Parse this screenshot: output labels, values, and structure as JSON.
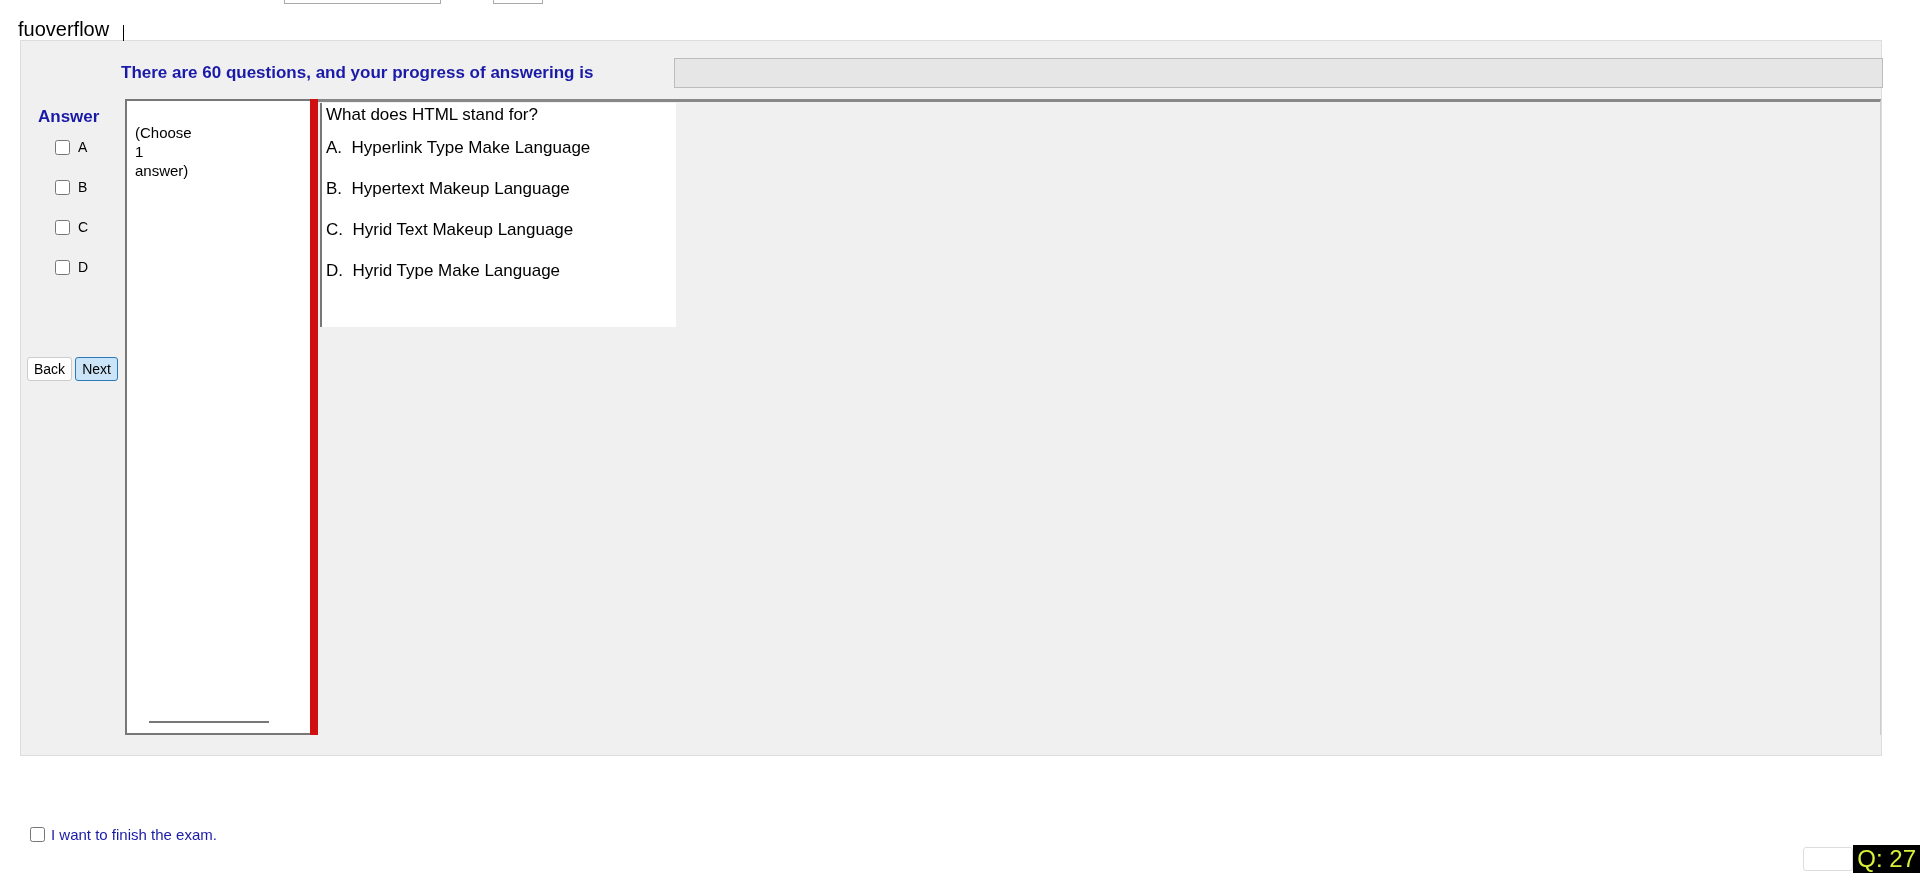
{
  "app_title": "fuoverflow",
  "progress": {
    "label": "There are 60 questions, and your progress of answering is",
    "level": 0
  },
  "answer_panel": {
    "title": "Answer",
    "options": [
      {
        "label": "A",
        "checked": false
      },
      {
        "label": "B",
        "checked": false
      },
      {
        "label": "C",
        "checked": false
      },
      {
        "label": "D",
        "checked": false
      }
    ]
  },
  "nav_buttons": [
    {
      "label": "Back",
      "selected": false
    },
    {
      "label": "Next",
      "selected": true
    }
  ],
  "instruction": [
    "(Choose",
    "1",
    "answer)"
  ],
  "question": {
    "text": "What does HTML stand for?",
    "choices": [
      "A.  Hyperlink Type Make Language",
      "B.  Hypertext Makeup Language",
      "C.  Hyrid Text Makeup Language",
      "D.  Hyrid Type Make Language"
    ]
  },
  "finish": {
    "label": "I want to finish the exam.",
    "checked": false
  },
  "question_badge": "Q: 27"
}
